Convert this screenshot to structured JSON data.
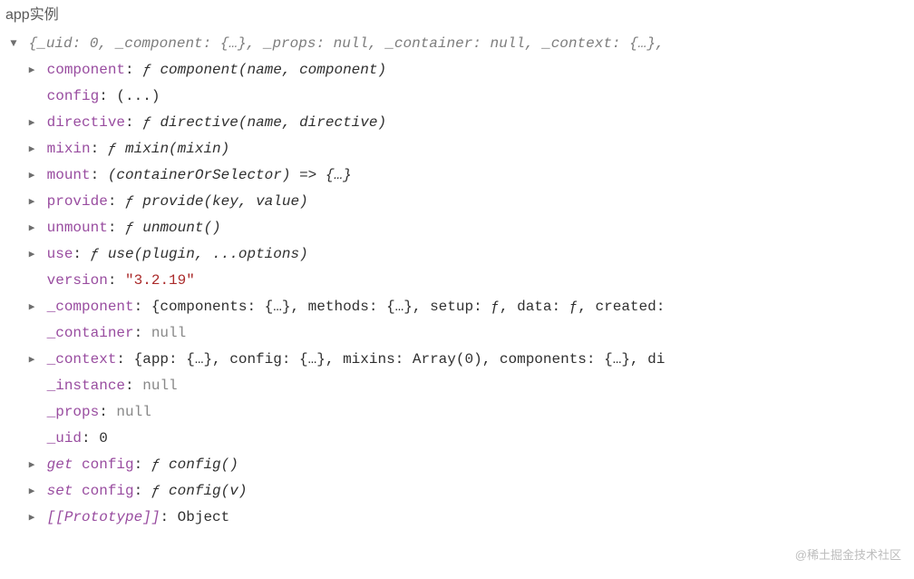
{
  "title": "app实例",
  "header": {
    "parts": [
      {
        "key": "_uid",
        "value": "0"
      },
      {
        "key": "_component",
        "value": "{…}"
      },
      {
        "key": "_props",
        "value": "null"
      },
      {
        "key": "_container",
        "value": "null"
      },
      {
        "key": "_context",
        "value": "{…}"
      }
    ],
    "prefix": "{",
    "suffix": ","
  },
  "rows": [
    {
      "arrow": "▶",
      "key": "component",
      "italic": true,
      "sig_sym": "ƒ ",
      "sig_name": "component",
      "sig_args": "(name, component)"
    },
    {
      "arrow": "",
      "key": "config",
      "plain": "(...)"
    },
    {
      "arrow": "▶",
      "key": "directive",
      "italic": true,
      "sig_sym": "ƒ ",
      "sig_name": "directive",
      "sig_args": "(name, directive)"
    },
    {
      "arrow": "▶",
      "key": "mixin",
      "italic": true,
      "sig_sym": "ƒ ",
      "sig_name": "mixin",
      "sig_args": "(mixin)"
    },
    {
      "arrow": "▶",
      "key": "mount",
      "italic": true,
      "sig_plain": "(containerOrSelector) => {…}"
    },
    {
      "arrow": "▶",
      "key": "provide",
      "italic": true,
      "sig_sym": "ƒ ",
      "sig_name": "provide",
      "sig_args": "(key, value)"
    },
    {
      "arrow": "▶",
      "key": "unmount",
      "italic": true,
      "sig_sym": "ƒ ",
      "sig_name": "unmount",
      "sig_args": "()"
    },
    {
      "arrow": "▶",
      "key": "use",
      "italic": true,
      "sig_sym": "ƒ ",
      "sig_name": "use",
      "sig_args": "(plugin, ...options)"
    },
    {
      "arrow": "",
      "key": "version",
      "string_value": "\"3.2.19\""
    },
    {
      "arrow": "▶",
      "key": "_component",
      "obj_value": "{components: {…}, methods: {…}, setup: ƒ, data: ƒ, created:"
    },
    {
      "arrow": "",
      "key": "_container",
      "null_value": "null"
    },
    {
      "arrow": "▶",
      "key": "_context",
      "obj_value": "{app: {…}, config: {…}, mixins: Array(0), components: {…}, di"
    },
    {
      "arrow": "",
      "key": "_instance",
      "null_value": "null"
    },
    {
      "arrow": "",
      "key": "_props",
      "null_value": "null"
    },
    {
      "arrow": "",
      "key": "_uid",
      "num_value": "0"
    },
    {
      "arrow": "▶",
      "key_prefix": "get ",
      "key": "config",
      "italic": true,
      "sig_sym": "ƒ ",
      "sig_name": "config",
      "sig_args": "()"
    },
    {
      "arrow": "▶",
      "key_prefix": "set ",
      "key": "config",
      "italic": true,
      "sig_sym": "ƒ ",
      "sig_name": "config",
      "sig_args": "(v)"
    },
    {
      "arrow": "▶",
      "key_special": "[[Prototype]]",
      "proto_value": "Object"
    }
  ],
  "watermark": "@稀土掘金技术社区"
}
